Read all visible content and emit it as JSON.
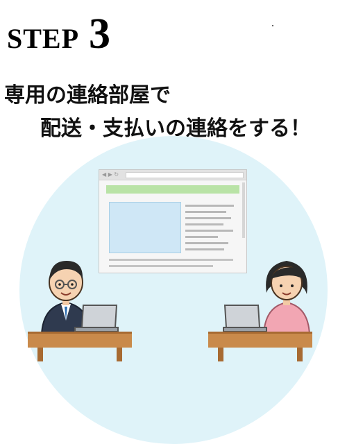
{
  "heading": {
    "step_word": "STEP",
    "step_number": "3"
  },
  "caption": {
    "line1": "専用の連絡部屋で",
    "line2": "配送・支払いの連絡をする！"
  },
  "colors": {
    "background_circle": "#dff3f9",
    "banner": "#b9e3a6",
    "image": "#cfe7f6"
  },
  "browser": {
    "nav_icons": "◀ ▶ ↻"
  }
}
